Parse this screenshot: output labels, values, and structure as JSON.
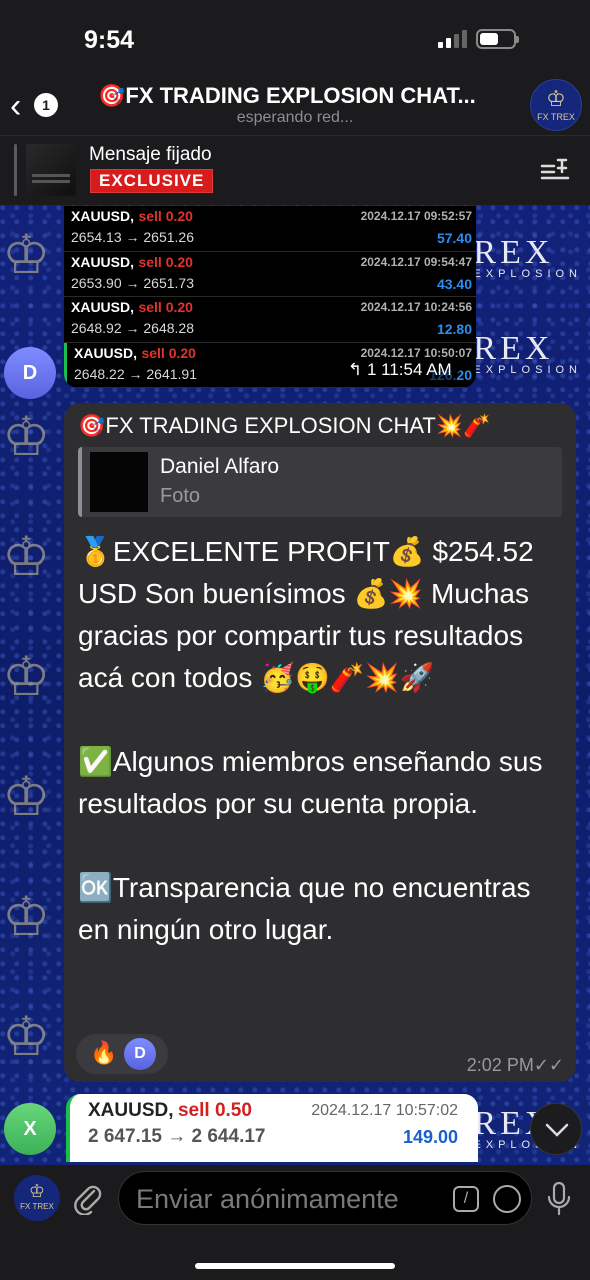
{
  "status_bar": {
    "time": "9:54"
  },
  "header": {
    "back_count": "1",
    "title": "🎯FX TRADING EXPLOSION CHAT...",
    "subtitle": "esperando red...",
    "channel_avatar_text": "FX TREX"
  },
  "pinned": {
    "title": "Mensaje fijado",
    "badge": "EXCLUSIVE"
  },
  "watermark": {
    "brand": "REX",
    "sub": "EXPLOSION"
  },
  "top_trades": [
    {
      "symbol": "XAUUSD,",
      "side": "sell 0.20",
      "timestamp": "2024.12.17 09:52:57",
      "prices": "2654.13 → 2651.26",
      "profit": "57.40"
    },
    {
      "symbol": "XAUUSD,",
      "side": "sell 0.20",
      "timestamp": "2024.12.17 09:54:47",
      "prices": "2653.90 → 2651.73",
      "profit": "43.40"
    },
    {
      "symbol": "XAUUSD,",
      "side": "sell 0.20",
      "timestamp": "2024.12.17 10:24:56",
      "prices": "2648.92 → 2648.28",
      "profit": "12.80"
    },
    {
      "symbol": "XAUUSD,",
      "side": "sell 0.20",
      "timestamp": "2024.12.17 10:50:07",
      "prices": "2648.22 → 2641.91",
      "profit": "126.20"
    }
  ],
  "top_message": {
    "replies": "↰ 1 11:54 AM",
    "avatar_letter": "D"
  },
  "message": {
    "sender": "🎯FX TRADING EXPLOSION CHAT💥🧨",
    "reply_name": "Daniel Alfaro",
    "reply_type": "Foto",
    "p1": "🥇EXCELENTE PROFIT💰 $254.52 USD Son buenísimos 💰💥 Muchas gracias por compartir tus resultados acá con todos 🥳🤑🧨💥🚀",
    "p2": "✅Algunos miembros enseñando sus resultados por su cuenta propia.",
    "p3": "🆗Transparencia que no encuentras en ningún otro lugar.",
    "reaction_emoji": "🔥",
    "reaction_avatar": "D",
    "time": "2:02 PM✓✓"
  },
  "bottom_trade": {
    "avatar_letter": "X",
    "symbol": "XAUUSD,",
    "side": "sell 0.50",
    "timestamp": "2024.12.17 10:57:02",
    "prices": "2 647.15 → 2 644.17",
    "profit": "149.00"
  },
  "input": {
    "placeholder": "Enviar anónimamente",
    "avatar_text": "FX TREX"
  },
  "colors": {
    "sell": "#e2332c",
    "profit": "#2d8cf0",
    "accent_green": "#1dbf4b",
    "bubble": "#2e2e31"
  }
}
